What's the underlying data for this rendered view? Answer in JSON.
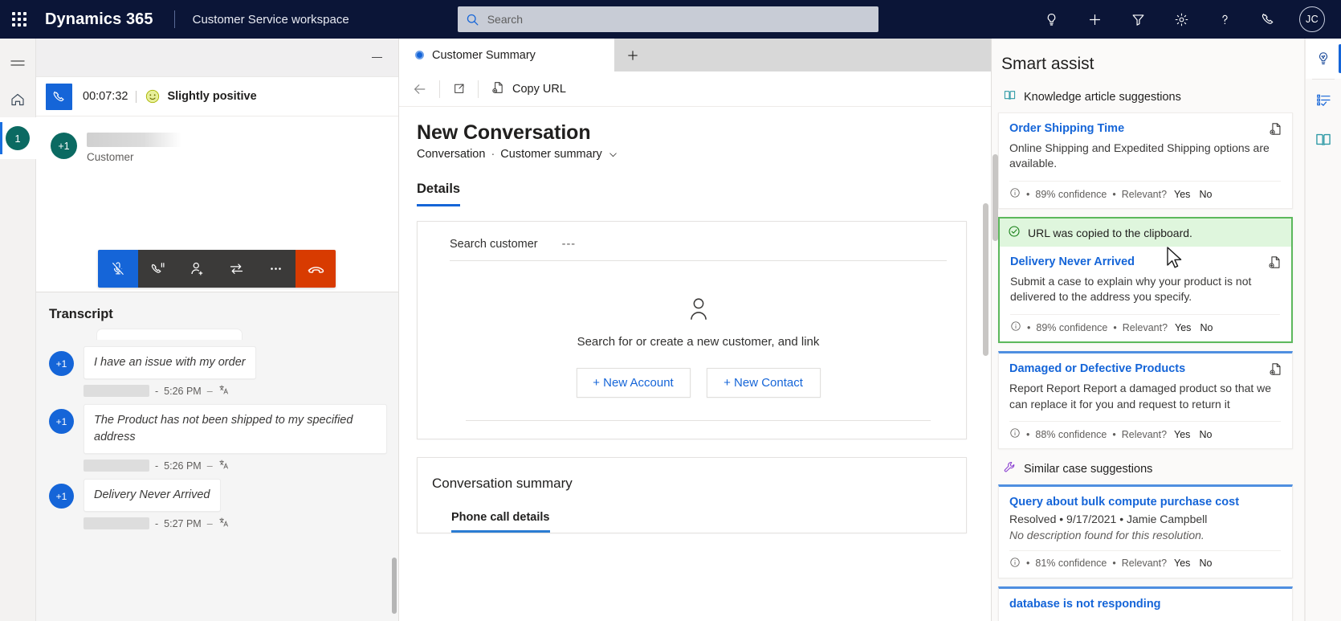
{
  "topnav": {
    "waffle_label": "App launcher",
    "brand": "Dynamics 365",
    "app_name": "Customer Service workspace",
    "search_placeholder": "Search",
    "search_value": "",
    "icons": [
      "lightbulb-icon",
      "plus-icon",
      "filter-icon",
      "gear-icon",
      "help-icon",
      "phone-icon"
    ],
    "avatar_initials": "JC"
  },
  "leftrail": {
    "hamburger": "Site map",
    "home": "Home",
    "session_badge": "1"
  },
  "conversation": {
    "minimize_label": "Minimize",
    "call_timer": "00:07:32",
    "sentiment": "Slightly positive",
    "participant": {
      "avatar": "+1",
      "name_redacted": true,
      "role": "Customer"
    },
    "call_controls": [
      {
        "name": "mute-button",
        "label": "Mute"
      },
      {
        "name": "hold-button",
        "label": "Hold"
      },
      {
        "name": "consult-button",
        "label": "Consult"
      },
      {
        "name": "transfer-button",
        "label": "Transfer"
      },
      {
        "name": "more-options-button",
        "label": "More options"
      },
      {
        "name": "end-call-button",
        "label": "End call"
      }
    ],
    "transcript_title": "Transcript",
    "messages": [
      {
        "avatar": "+1",
        "text": "I have an issue with my order",
        "time": "5:26 PM",
        "dash": "–",
        "translate_icon": "translate-icon"
      },
      {
        "avatar": "+1",
        "text": "The Product has not been shipped to my specified address",
        "time": "5:26 PM",
        "dash": "–",
        "translate_icon": "translate-icon"
      },
      {
        "avatar": "+1",
        "text": "Delivery Never Arrived",
        "time": "5:27 PM",
        "dash": "–",
        "translate_icon": "translate-icon"
      }
    ]
  },
  "main": {
    "tab_label": "Customer Summary",
    "add_tab_label": "+",
    "commands": {
      "back": "Back",
      "popout": "Pop out",
      "copy_url": "Copy URL"
    },
    "page_title": "New Conversation",
    "breadcrumb_entity": "Conversation",
    "breadcrumb_sep": "·",
    "breadcrumb_form": "Customer summary",
    "details_tab": "Details",
    "customer_card": {
      "search_label": "Search customer",
      "search_value": "---",
      "empty_text": "Search for or create a new customer, and link",
      "new_account_btn": "+ New Account",
      "new_contact_btn": "+ New Contact"
    },
    "summary_card": {
      "title": "Conversation summary",
      "tab": "Phone call details"
    }
  },
  "smart_assist": {
    "title": "Smart assist",
    "groups": [
      {
        "icon": "book-icon",
        "title": "Knowledge article suggestions",
        "cards": [
          {
            "style": "plain",
            "toast": null,
            "title": "Order Shipping Time",
            "desc": "Online Shipping and Expedited Shipping options are available.",
            "confidence": "89% confidence",
            "relevant_label": "Relevant?",
            "yes": "Yes",
            "no": "No",
            "copy_icon": "copy-link-icon"
          },
          {
            "style": "highlight",
            "toast": "URL was copied to the clipboard.",
            "title": "Delivery Never Arrived",
            "desc": "Submit a case to explain why your product is not delivered to the address you specify.",
            "confidence": "89% confidence",
            "relevant_label": "Relevant?",
            "yes": "Yes",
            "no": "No",
            "copy_icon": "copy-link-icon"
          },
          {
            "style": "topbar",
            "toast": null,
            "title": "Damaged or Defective Products",
            "desc": "Report Report Report a damaged product so that we can replace it for you and request to return it",
            "confidence": "88% confidence",
            "relevant_label": "Relevant?",
            "yes": "Yes",
            "no": "No",
            "copy_icon": "copy-link-icon"
          }
        ]
      },
      {
        "icon": "wrench-icon",
        "title": "Similar case suggestions",
        "cards": [
          {
            "style": "topbar",
            "title": "Query about bulk compute purchase cost",
            "sub": "Resolved • 9/17/2021 • Jamie Campbell",
            "meta_italic": "No description found for this resolution.",
            "confidence": "81% confidence",
            "relevant_label": "Relevant?",
            "yes": "Yes",
            "no": "No"
          },
          {
            "style": "topbar",
            "title": "database is not responding"
          }
        ]
      }
    ]
  },
  "rightrail": {
    "items": [
      {
        "name": "smart-assist-icon",
        "label": "Smart assist",
        "active": true
      },
      {
        "name": "agenda-icon",
        "label": "Agenda"
      },
      {
        "name": "knowledge-icon",
        "label": "Knowledge search"
      }
    ]
  },
  "colors": {
    "nav_bg": "#0b1537",
    "accent": "#1565d8",
    "teal": "#0b6a62",
    "success_bg": "#dff6dd",
    "success_border": "#5cb85c",
    "danger": "#d83b01"
  }
}
